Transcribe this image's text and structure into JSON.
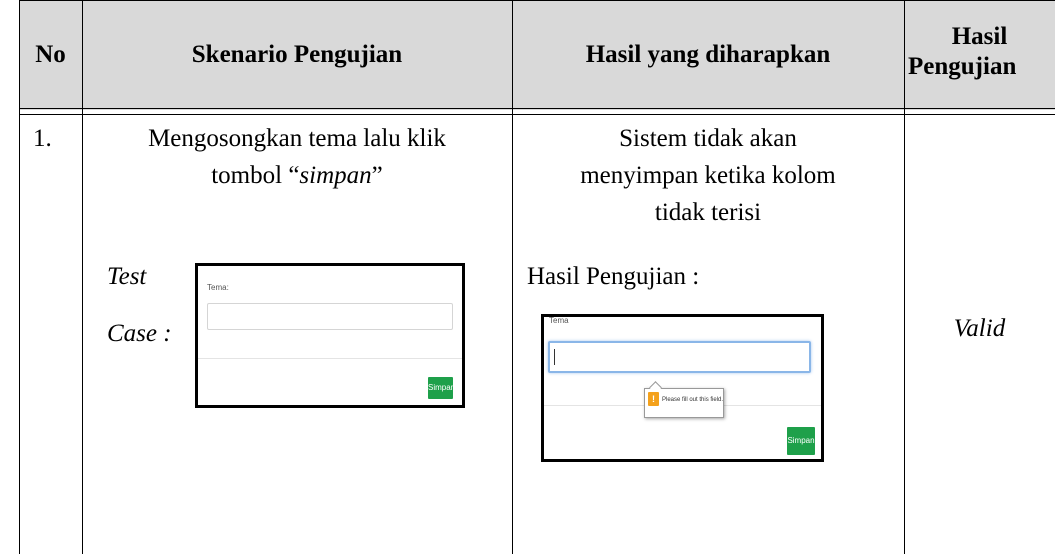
{
  "table": {
    "headers": {
      "no": "No",
      "skenario": "Skenario Pengujian",
      "hasil_diharapkan": "Hasil yang diharapkan",
      "hasil_pengujian_line1": "Hasil",
      "hasil_pengujian_line2": "Pengujian"
    },
    "rows": [
      {
        "no": "1.",
        "skenario_line1": "Mengosongkan tema lalu klik",
        "skenario_line2_prefix": "tombol “",
        "skenario_line2_italic": "simpan",
        "skenario_line2_suffix": "”",
        "test_label_line1": "Test",
        "test_label_line2": "Case :",
        "expected_line1": "Sistem tidak akan",
        "expected_line2": "menyimpan ketika kolom",
        "expected_line3": "tidak terisi",
        "hasil_pengujian_label": "Hasil Pengujian :",
        "result": "Valid"
      }
    ]
  },
  "test_case_form": {
    "field_label": "Tema:",
    "field_value": "",
    "button_label": "Simpan",
    "button_color": "#1ea04a"
  },
  "result_form": {
    "field_label": "Tema",
    "field_value": "",
    "tooltip_text": "Please fill out this field.",
    "warning_symbol": "!",
    "button_label": "Simpan",
    "focus_color": "#8ab6e8"
  }
}
